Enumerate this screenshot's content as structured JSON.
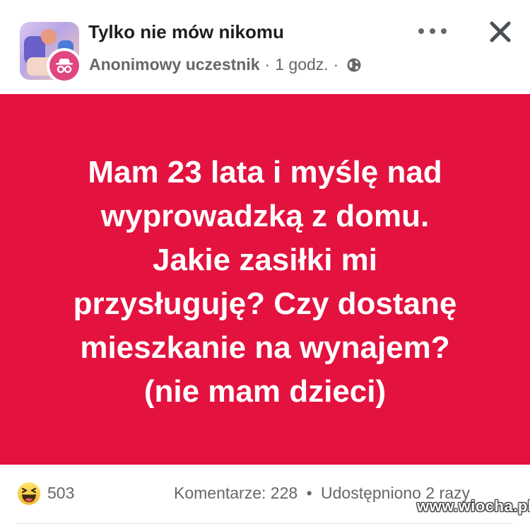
{
  "header": {
    "group_name": "Tylko nie mów nikomu",
    "author": "Anonimowy uczestnik",
    "separator": "·",
    "time": "1 godz.",
    "visibility_icon": "globe-icon",
    "more_icon": "more-options-icon",
    "close_icon": "close-icon"
  },
  "post": {
    "background_color": "#e4123f",
    "text_color": "#ffffff",
    "lines": [
      "Mam 23 lata i myślę nad",
      "wyprowadzką z domu.",
      "Jakie zasiłki mi",
      "przysługuję? Czy dostanę",
      "mieszkanie na wynajem?",
      "(nie mam dzieci)"
    ]
  },
  "footer": {
    "reaction_icon": "haha-reaction-icon",
    "reaction_count": "503",
    "comments": "Komentarze: 228",
    "dot": "•",
    "shares": "Udostępniono 2 razy"
  },
  "watermark": "www.wiocha.pl"
}
